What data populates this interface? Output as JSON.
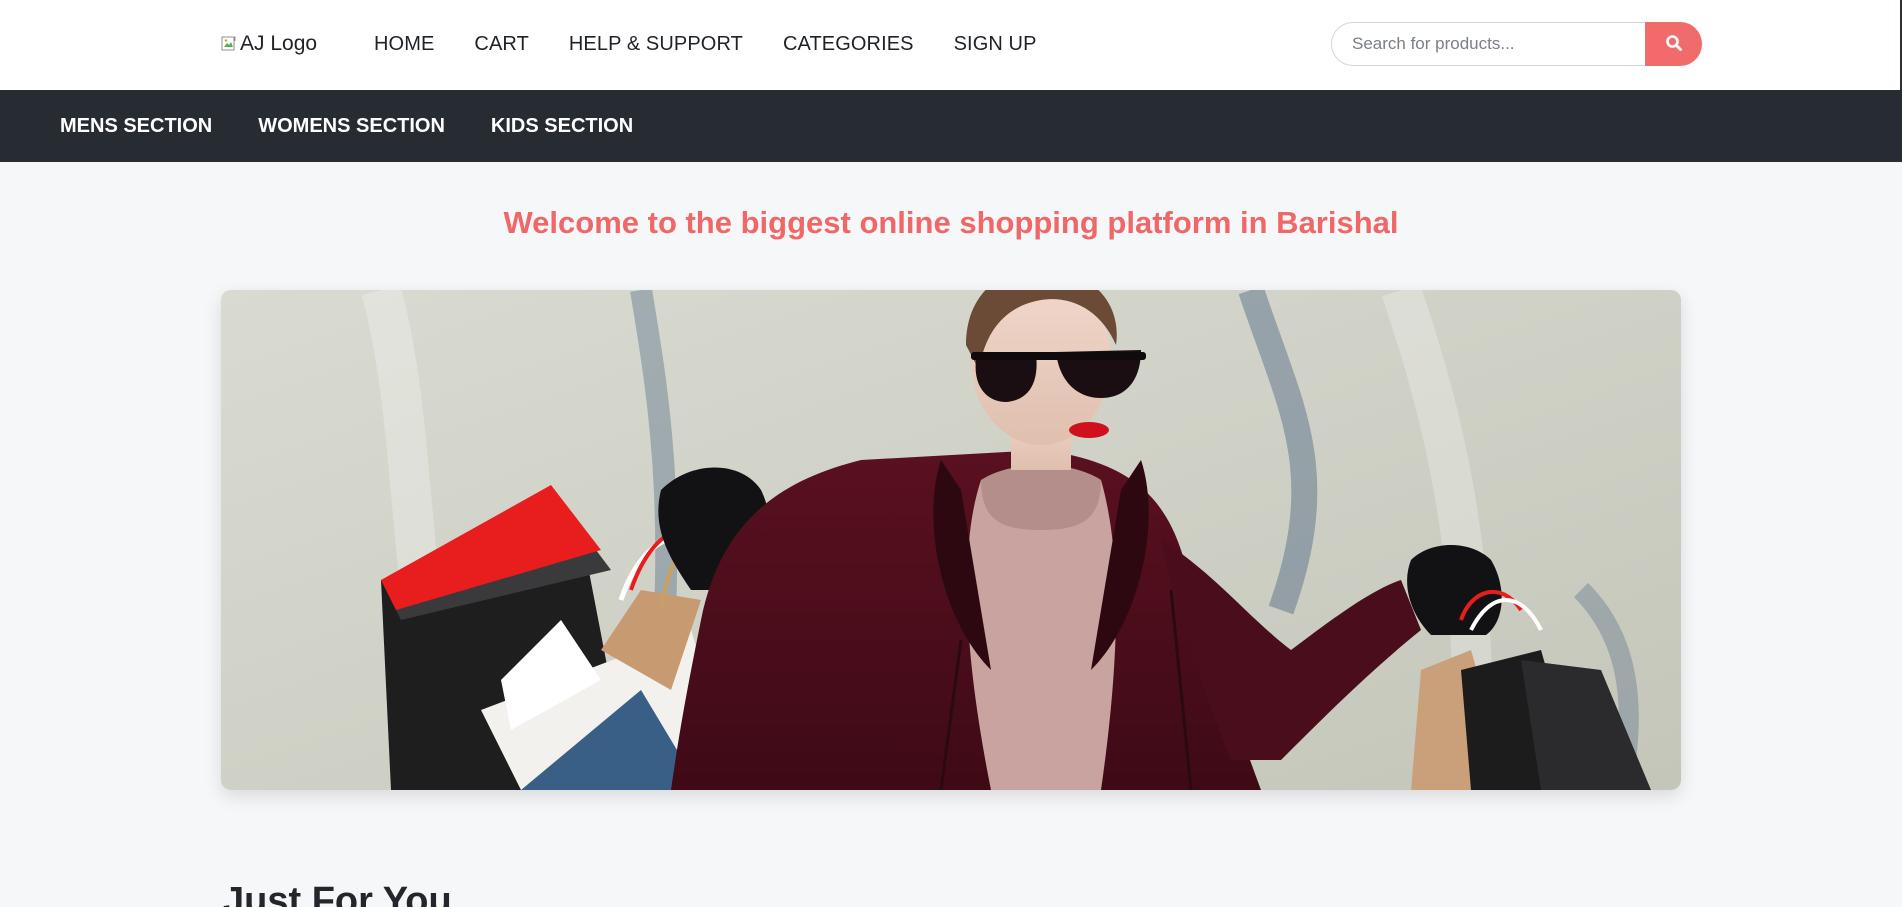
{
  "header": {
    "logo_alt": "AJ Logo",
    "nav": [
      {
        "label": "HOME"
      },
      {
        "label": "CART"
      },
      {
        "label": "HELP & SUPPORT"
      },
      {
        "label": "CATEGORIES"
      },
      {
        "label": "SIGN UP"
      }
    ],
    "search": {
      "placeholder": "Search for products...",
      "value": "",
      "icon": "search-icon"
    }
  },
  "sections_nav": {
    "items": [
      {
        "label": "MENS SECTION"
      },
      {
        "label": "WOMENS SECTION"
      },
      {
        "label": "KIDS SECTION"
      }
    ]
  },
  "welcome": {
    "text": "Welcome to the biggest online shopping platform in Barishal"
  },
  "hero": {
    "image_alt": "Woman in sunglasses and burgundy coat holding shopping bags"
  },
  "just_for_you": {
    "heading": "Just For You"
  },
  "colors": {
    "accent": "#f26b6b",
    "heading_accent": "#ef6767",
    "section_bar": "#272c33",
    "page_bg": "#f6f7f9"
  }
}
